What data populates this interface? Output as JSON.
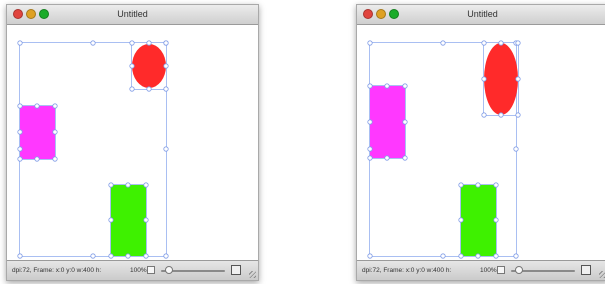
{
  "windows": [
    {
      "title": "Untitled",
      "status": "dpi:72, Frame: x:0 y:0 w:400  h:",
      "zoom": "100%",
      "shapes": {
        "ellipse_color": "#ff2a2a",
        "rect_magenta_color": "#ff38ff",
        "rect_green_color": "#3ef100"
      }
    },
    {
      "title": "Untitled",
      "status": "dpi:72, Frame: x:0 y:0 w:400  h:",
      "zoom": "100%",
      "shapes": {
        "ellipse_color": "#ff2a2a",
        "rect_magenta_color": "#ff38ff",
        "rect_green_color": "#3ef100"
      }
    }
  ],
  "colors": {
    "selection_outline": "#a9bff2",
    "handle_fill": "#ffffff",
    "handle_stroke": "#7f9be6"
  },
  "icons": {
    "close": "close-icon",
    "minimize": "minimize-icon",
    "zoom": "zoom-icon",
    "zoom_out": "zoom-out-icon",
    "zoom_in": "zoom-in-icon",
    "resize": "resize-grip-icon"
  }
}
